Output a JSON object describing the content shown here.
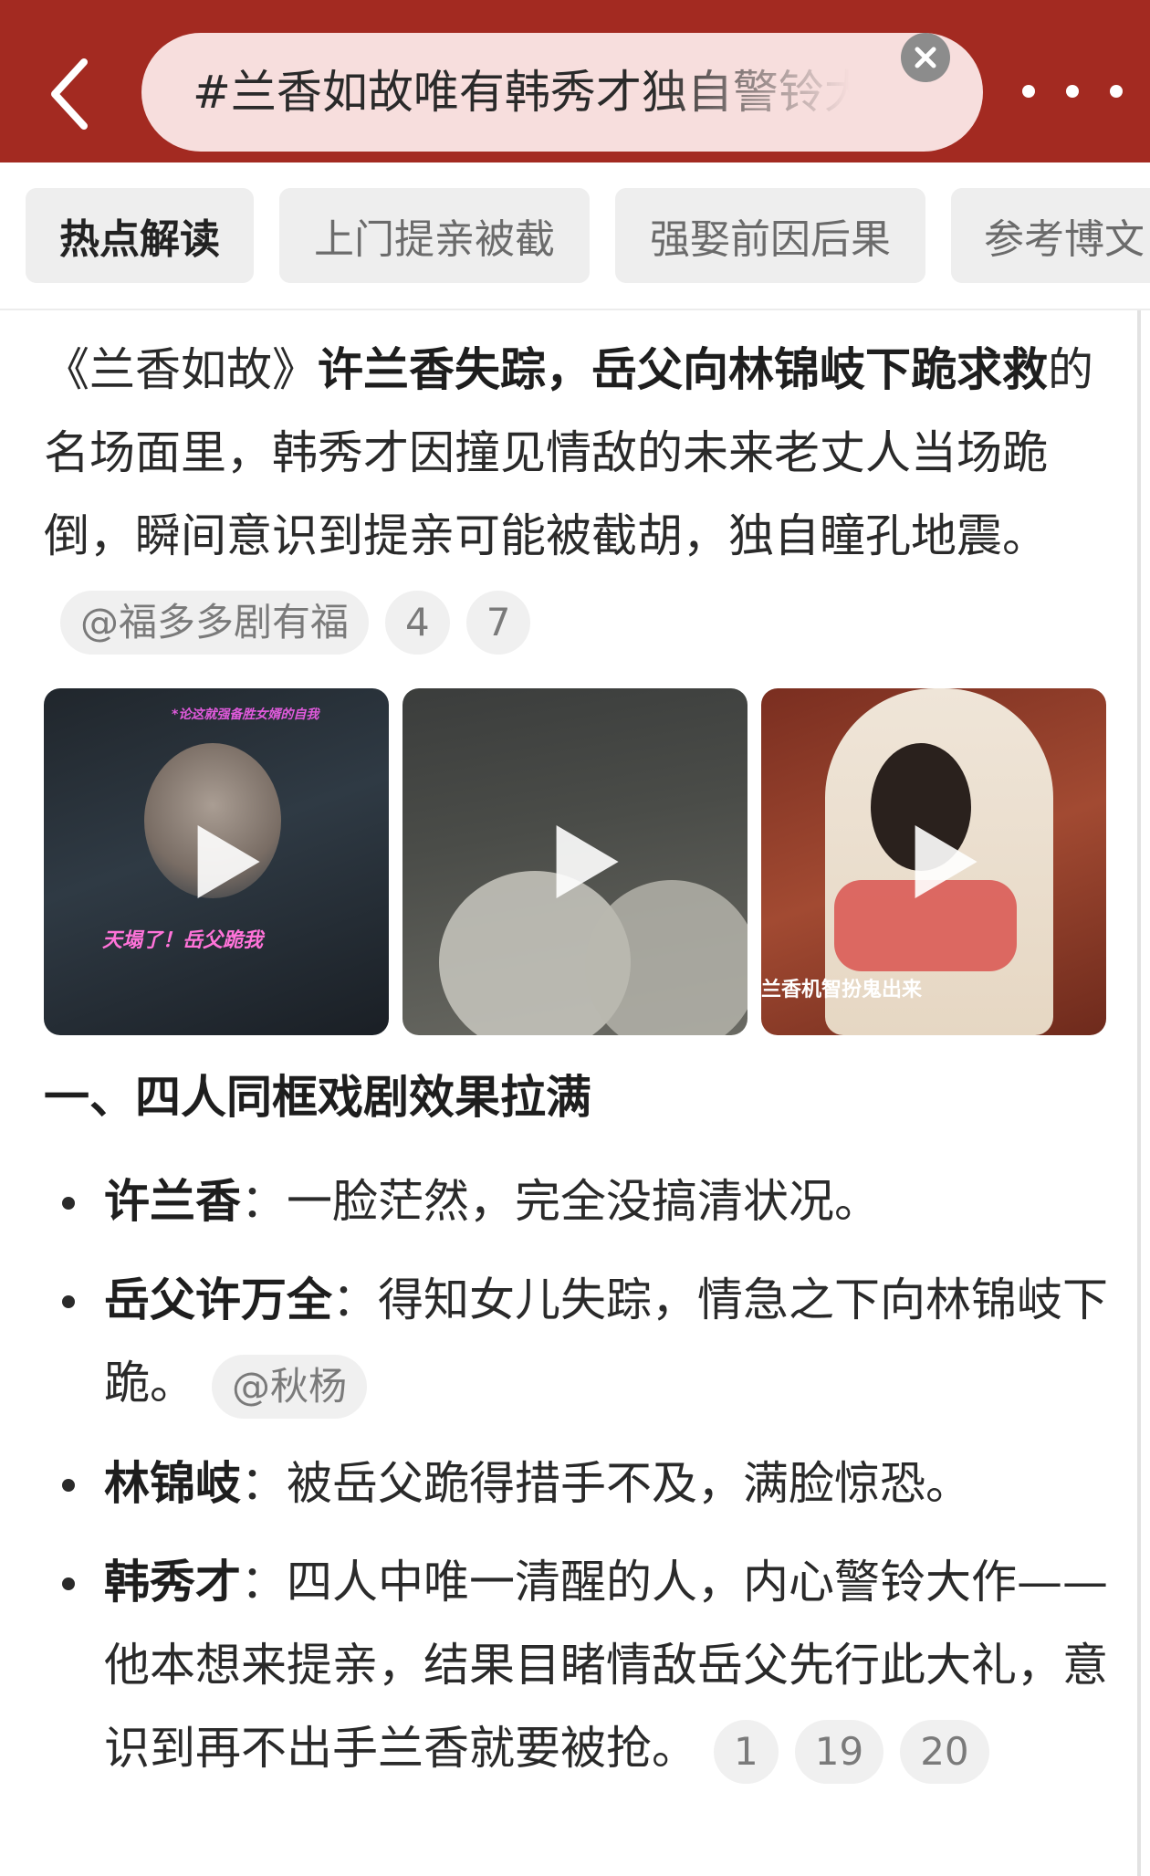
{
  "header": {
    "search_text": "#兰香如故唯有韩秀才独自警铃大作#",
    "accent_color": "#a32a21"
  },
  "tabs": [
    {
      "label": "热点解读",
      "active": true
    },
    {
      "label": "上门提亲被截",
      "active": false
    },
    {
      "label": "强娶前因后果",
      "active": false
    },
    {
      "label": "参考博文",
      "active": false
    }
  ],
  "intro": {
    "plain_start": "《兰香如故》",
    "bold": "许兰香失踪，岳父向林锦岐下跪求救",
    "plain_rest": "的名场面里，韩秀才因撞见情敌的未来老丈人当场跪倒，瞬间意识到提亲可能被截胡，独自瞳孔地震。",
    "mention": "@福多多剧有福",
    "refs": [
      "4",
      "7"
    ]
  },
  "videos": [
    {
      "caption": "天塌了！岳父跪我",
      "top_caption": "*论这就强备胜女婿的自我"
    },
    {
      "caption": ""
    },
    {
      "caption": "兰香机智扮鬼出来"
    }
  ],
  "section": {
    "heading": "一、四人同框戏剧效果拉满",
    "bullets": [
      {
        "name": "许兰香",
        "sep": "：",
        "text": "一脸茫然，完全没搞清状况。",
        "mention": "",
        "refs": []
      },
      {
        "name": "岳父许万全",
        "sep": "：",
        "text": "得知女儿失踪，情急之下向林锦岐下跪。",
        "mention": "@秋杨",
        "refs": []
      },
      {
        "name": "林锦岐",
        "sep": "：",
        "text": "被岳父跪得措手不及，满脸惊恐。",
        "mention": "",
        "refs": []
      },
      {
        "name": "韩秀才",
        "sep": "：",
        "text": "四人中唯一清醒的人，内心警铃大作——他本想来提亲，结果目睹情敌岳父先行此大礼，意识到再不出手兰香就要被抢。",
        "mention": "",
        "refs": [
          "1",
          "19",
          "20"
        ]
      }
    ]
  }
}
